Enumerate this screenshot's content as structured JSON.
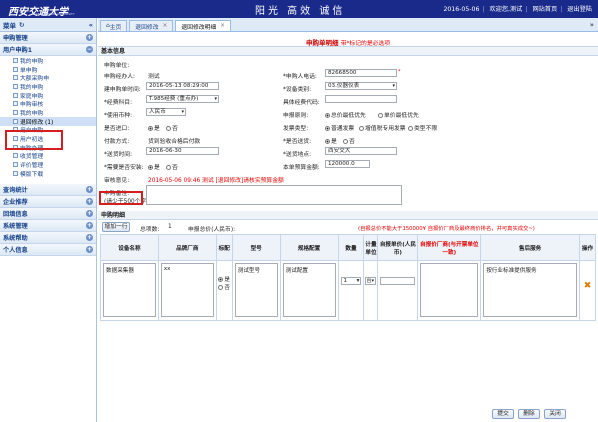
{
  "header": {
    "logo": "西安交通大学",
    "logo_sub": "XI'AN JIAOTONG UNIVERSITY",
    "slogan": "阳光  高效  诚信",
    "date": "2016-05-06",
    "welcome": "欢迎您,测试",
    "nav": "网站首页",
    "logout": "退出登陆"
  },
  "sidebar": {
    "title": "菜单",
    "groups": [
      {
        "label": "申购管理",
        "tog": "+"
      },
      {
        "label": "用户申购1",
        "tog": "−"
      },
      {
        "label": "查询统计",
        "tog": "+"
      },
      {
        "label": "企业推荐",
        "tog": "+"
      },
      {
        "label": "回填信息",
        "tog": "+"
      },
      {
        "label": "系统管理",
        "tog": "+"
      },
      {
        "label": "系统帮助",
        "tog": "+"
      },
      {
        "label": "个人信息",
        "tog": "+"
      }
    ],
    "items": [
      "我的申购",
      "单申购",
      "大额采购申",
      "我的申购",
      "家庭申购",
      "申购审核",
      "我的申购",
      "退回修改 (1)",
      "用户申购",
      "用户初选",
      "申购办理",
      "收货管理",
      "评价管理",
      "模版下载"
    ]
  },
  "tabs": [
    "主页",
    "退回修改",
    "退回修改明细"
  ],
  "form": {
    "title": "申购单明细",
    "title_note": "带*标记的是必选项",
    "section_basic": "基本信息",
    "order_no_label": "申购单位:",
    "applicant_label": "申购经办人:",
    "applicant": "测试",
    "phone_label": "*申购人电话:",
    "phone": "82668500",
    "created_label": "建申购单时间:",
    "created": "2016-05-13 08:29:00",
    "device_label": "*设备类别:",
    "device": "03.仪器仪表",
    "budget_label": "*经费科目:",
    "budget": "T.985经费 (重点办)",
    "budget_code_label": "具体经费代码:",
    "currency_label": "*使用币种:",
    "currency": "人民币",
    "principle_label": "申报原则:",
    "principle_1": "总价最低优先",
    "principle_2": "单价最低优先",
    "invoice_label": "发票类型:",
    "invoice_1": "普通发票",
    "invoice_2": "增值税专用发票",
    "invoice_3": "类型不限",
    "import_label": "是否进口:",
    "yes": "是",
    "no": "否",
    "delivery_label": "*是否送货:",
    "payment_label": "付款方式:",
    "payment": "货到验收合格后付款",
    "date_label": "*送货时间:",
    "date": "2016-06-30",
    "addr_label": "*送货地点:",
    "addr": "西安交大",
    "assembly_label": "*需要是否安装:",
    "budget_total_label": "本单预算金额:",
    "budget_total": "120000.0",
    "review_label": "审核意见:",
    "review_text": "2016-05-06 09:46  测试  [退回修改]请核实预算金额",
    "remark_label": "申购备注:",
    "remark_hint": "(请少于500个字)",
    "section_items": "申购明细",
    "add_row": "增加一行",
    "total_count_label": "总项数:",
    "total_count": "1",
    "total_price_label": "申报总价(人民币):",
    "warning": "(自报总价不能大于150000¥ 自报价厂商及最终商价排名，并可真实成交~)",
    "columns": [
      "设备名称",
      "品牌厂商",
      "标配",
      "型号",
      "规格配置",
      "数量",
      "计量单位",
      "自报单价(人民币)",
      "自报价厂商(与开票单位一致)",
      "售后服务",
      "操作"
    ],
    "row": {
      "name": "数据采集器",
      "brand": "xx",
      "std_yes": "是",
      "std_no": "否",
      "model": "测试型号",
      "config": "测试配置",
      "qty": "1",
      "unit": "台",
      "price": "",
      "vendor": "",
      "service": "按行业标准提供服务"
    },
    "btn_submit": "提交",
    "btn_delete": "删除",
    "btn_close": "关闭"
  }
}
